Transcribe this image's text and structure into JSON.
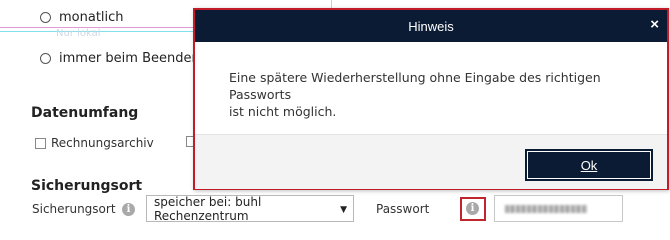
{
  "background": {
    "options": [
      {
        "label": "monatlich"
      },
      {
        "label": "immer beim Beenden vo"
      }
    ],
    "ghost_text": "Nur lokal",
    "datenumfang": {
      "title": "Datenumfang",
      "checkbox_label": "Rechnungsarchiv"
    },
    "sicherungsort": {
      "title": "Sicherungsort",
      "field_label": "Sicherungsort",
      "select_value": "speicher bei: buhl Rechenzentrum",
      "password_label": "Passwort"
    }
  },
  "dialog": {
    "title": "Hinweis",
    "close_symbol": "×",
    "message_line1": "Eine spätere Wiederherstellung ohne Eingabe des richtigen Passworts",
    "message_line2": "ist nicht möglich.",
    "ok_label": "Ok"
  },
  "colors": {
    "titlebar": "#0b1b33",
    "dialog_border": "#c21b2a",
    "highlight_border": "#c0262e"
  }
}
